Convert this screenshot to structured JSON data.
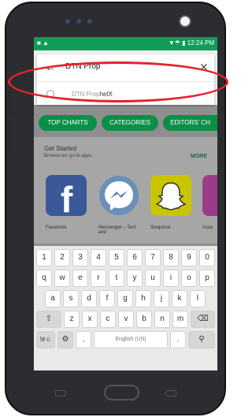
{
  "status": {
    "left": "■ ▲",
    "right": "▼☂ ▮ 12:24 PM"
  },
  "search": {
    "value": "DTN Prop",
    "suggestion_prefix": "DTN Prop",
    "suggestion_rest": "hetX"
  },
  "chips": [
    "TOP CHARTS",
    "CATEGORIES",
    "EDITORS' CH"
  ],
  "card": {
    "title": "Get Started",
    "subtitle": "Browse our go-to apps.",
    "more": "MORE"
  },
  "apps": [
    {
      "name": "Facebook",
      "color": "#3b5998",
      "glyph": "f",
      "icon": "facebook-icon"
    },
    {
      "name": "Messenger – Text and",
      "color": "#ffffff",
      "glyph": "⚡",
      "icon": "messenger-icon"
    },
    {
      "name": "Snapchat",
      "color": "#fffc00",
      "glyph": "👻",
      "icon": "snapchat-icon"
    },
    {
      "name": "Insta",
      "color": "#c13584",
      "glyph": "",
      "icon": "instagram-icon"
    }
  ],
  "keyboard": {
    "numbers": [
      "1",
      "2",
      "3",
      "4",
      "5",
      "6",
      "7",
      "8",
      "9",
      "0"
    ],
    "row1": [
      "q",
      "w",
      "e",
      "r",
      "t",
      "y",
      "u",
      "i",
      "o",
      "p"
    ],
    "row2": [
      "a",
      "s",
      "d",
      "f",
      "g",
      "h",
      "j",
      "k",
      "l"
    ],
    "row3": [
      "z",
      "x",
      "c",
      "v",
      "b",
      "n",
      "m"
    ],
    "shift": "⇧",
    "backspace": "⌫",
    "symbols": "!#☺",
    "settings": "⚙",
    "comma": ",",
    "space": "English (US)",
    "period": ".",
    "search": "⚲"
  },
  "colors": {
    "accent": "#0f9d58",
    "highlight": "#e3232b"
  }
}
